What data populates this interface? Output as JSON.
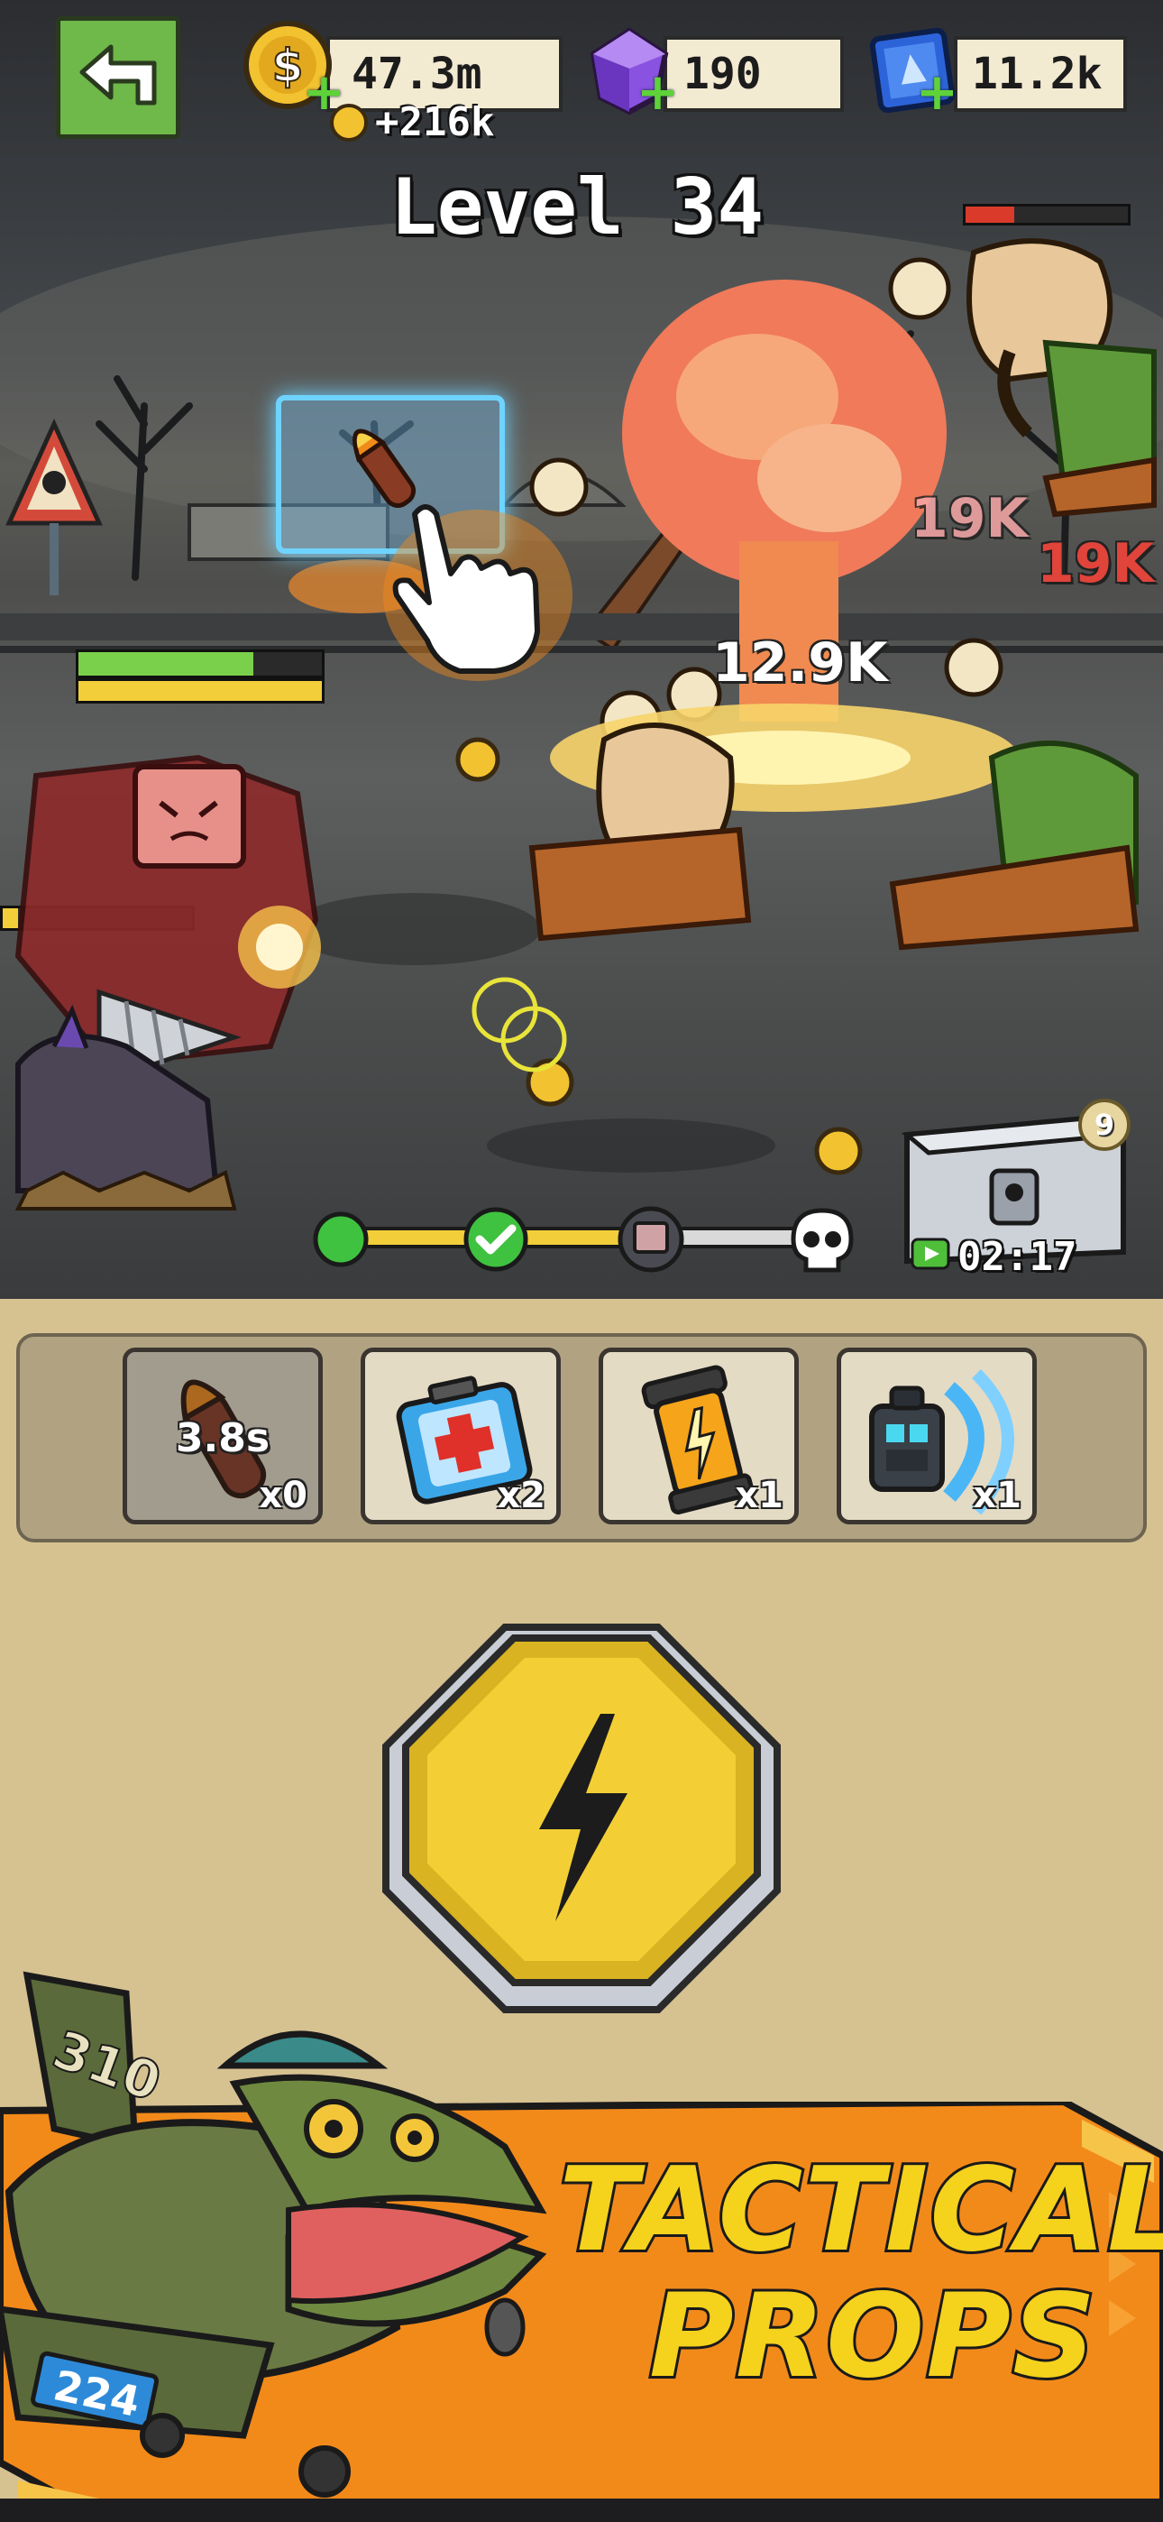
{
  "hud": {
    "gold": {
      "icon": "gold-coin-icon",
      "value": "47.3m",
      "income": "+216k"
    },
    "gems": {
      "icon": "purple-gem-icon",
      "value": "190"
    },
    "tickets": {
      "icon": "blue-card-icon",
      "value": "11.2k"
    }
  },
  "level": {
    "title": "Level 34"
  },
  "combat": {
    "damage_numbers": [
      "12.9K",
      "19K",
      "19K"
    ]
  },
  "wave_progress": {
    "nodes": [
      "completed",
      "completed",
      "boss",
      "skull"
    ]
  },
  "chest": {
    "badge": "9",
    "timer": "02:17"
  },
  "props": [
    {
      "name": "missile",
      "icon": "missile-icon",
      "count": "x0",
      "cooldown": "3.8s"
    },
    {
      "name": "medkit",
      "icon": "medkit-icon",
      "count": "x2"
    },
    {
      "name": "energy-lantern",
      "icon": "energy-canister-icon",
      "count": "x1"
    },
    {
      "name": "sonic-device",
      "icon": "sonic-emitter-icon",
      "count": "x1"
    }
  ],
  "action_button": {
    "icon": "lightning-icon"
  },
  "banner": {
    "line1": "TACTICAL",
    "line2": "PROPS",
    "plane_tail": "310",
    "plane_body": "224"
  },
  "colors": {
    "accent_yellow": "#f5d21c",
    "banner_orange": "#f28a1a",
    "hp_green": "#7ad04a"
  }
}
